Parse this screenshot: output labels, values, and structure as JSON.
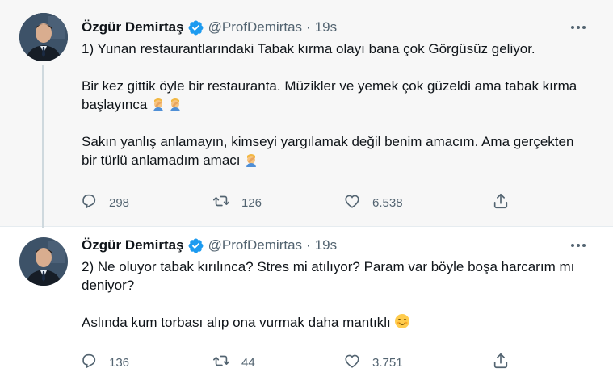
{
  "tweets": [
    {
      "author": {
        "name": "Özgür Demirtaş",
        "handle": "@ProfDemirtas",
        "verified": true
      },
      "time": "19s",
      "paragraphs": [
        "1) Yunan restaurantlarındaki Tabak kırma olayı bana çok Görgüsüz geliyor.",
        "Bir kez gittik öyle bir restauranta. Müzikler ve yemek çok güzeldi ama tabak kırma başlayınca",
        "Sakın yanlış anlamayın, kimseyi yargılamak değil benim amacım. Ama gerçekten bir türlü anlamadım amacı"
      ],
      "emojis": [
        "facepalm-emoji",
        "facepalm-emoji",
        "facepalm-emoji"
      ],
      "stats": {
        "replies": "298",
        "retweets": "126",
        "likes": "6.538"
      }
    },
    {
      "author": {
        "name": "Özgür Demirtaş",
        "handle": "@ProfDemirtas",
        "verified": true
      },
      "time": "19s",
      "paragraphs": [
        "2) Ne oluyor tabak kırılınca? Stres mi atılıyor? Param var böyle boşa harcarım mı deniyor?",
        "Aslında kum torbası alıp ona vurmak daha mantıklı"
      ],
      "emojis": [
        "smiling-blush-emoji"
      ],
      "stats": {
        "replies": "136",
        "retweets": "44",
        "likes": "3.751"
      }
    }
  ],
  "separator": "·",
  "icons": [
    "verified-badge-icon",
    "more-icon",
    "reply-icon",
    "retweet-icon",
    "like-icon",
    "share-icon"
  ],
  "colors": {
    "verified": "#1d9bf0",
    "secondary_text": "#536471",
    "thread_line": "#cfd9de",
    "highlight_bg": "#f7f7f7"
  }
}
